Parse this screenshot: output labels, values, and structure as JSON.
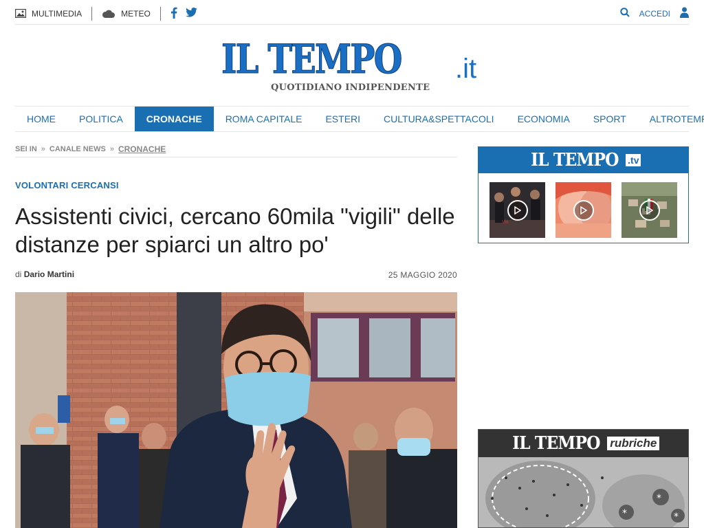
{
  "topbar": {
    "multimedia": "MULTIMEDIA",
    "meteo": "METEO",
    "accedi": "ACCEDI"
  },
  "logo": {
    "main": "IL TEMPO",
    "domain": ".it",
    "tagline": "QUOTIDIANO INDIPENDENTE"
  },
  "nav": {
    "items": [
      "HOME",
      "POLITICA",
      "CRONACHE",
      "ROMA CAPITALE",
      "ESTERI",
      "CULTURA&SPETTACOLI",
      "ECONOMIA",
      "SPORT",
      "ALTROTEMPO"
    ],
    "active": "CRONACHE"
  },
  "breadcrumb": {
    "sei_in": "SEI IN",
    "sep": "»",
    "canale": "CANALE NEWS",
    "current": "CRONACHE"
  },
  "article": {
    "kicker": "VOLONTARI CERCANSI",
    "title": "Assistenti civici, cercano 60mila \"vigili\" delle distanze per spiarci un altro po'",
    "by_prefix": "di",
    "author": "Dario Martini",
    "date": "25 MAGGIO 2020"
  },
  "tv": {
    "logo": "IL TEMPO",
    "tag": ".tv"
  },
  "rubriche": {
    "logo": "IL TEMPO",
    "tag": "rubriche"
  },
  "colors": {
    "brand_blue": "#1a6fb3",
    "rubriche_dark": "#333333"
  },
  "icons": [
    "image-icon",
    "cloud-icon",
    "facebook-icon",
    "twitter-icon",
    "search-icon",
    "user-icon",
    "play-icon"
  ]
}
